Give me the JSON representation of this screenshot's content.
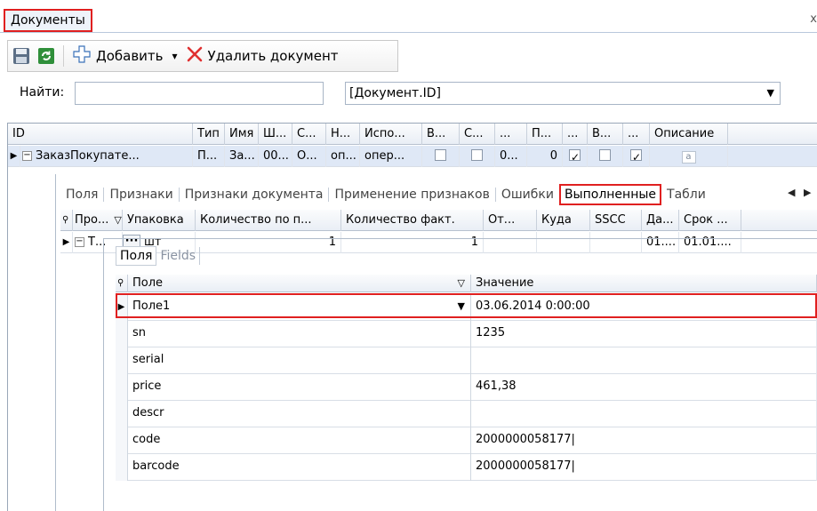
{
  "window": {
    "tab_title": "Документы",
    "close_glyph": "x"
  },
  "toolbar": {
    "save_icon": "save-icon",
    "refresh_icon": "refresh-icon",
    "add_label": "Добавить",
    "add_dropdown_glyph": "▾",
    "delete_label": "Удалить документ"
  },
  "search": {
    "label": "Найти:",
    "value": "",
    "field_value": "[Документ.ID]"
  },
  "grid": {
    "headers": [
      "ID",
      "Тип",
      "Имя",
      "Ш...",
      "С...",
      "Н...",
      "Испо...",
      "В...",
      "С...",
      "...",
      "П...",
      "...",
      "В...",
      "...",
      "Описание"
    ],
    "row": {
      "id": "ЗаказПокупате...",
      "type": "П...",
      "name": "За...",
      "sh": "00...",
      "s": "О...",
      "n": "оп...",
      "ispo": "опер...",
      "b_checked": false,
      "c_checked": false,
      "dots1": "0...",
      "p": "0",
      "dots2_checked": true,
      "v_checked": false,
      "dots3_checked": true,
      "description_icon": "a"
    }
  },
  "detail_tabs": [
    "Поля",
    "Признаки",
    "Признаки документа",
    "Применение признаков",
    "Ошибки",
    "Выполненные",
    "Табли"
  ],
  "detail_tabs_active": "Выполненные",
  "executed": {
    "headers": [
      "Про...",
      "Упаковка",
      "Количество по п...",
      "Количество факт.",
      "От...",
      "Куда",
      "SSCC",
      "Да...",
      "Срок ..."
    ],
    "row": {
      "pro": "Т...",
      "ellipsis_button": "···",
      "pack": "шт",
      "qty_plan": "1",
      "qty_fact": "1",
      "from": "",
      "to": "",
      "sscc": "",
      "date": "01....",
      "term": "01.01...."
    }
  },
  "inner_tabs": [
    "Поля",
    "Fields"
  ],
  "fields": {
    "headers": {
      "field": "Поле",
      "value": "Значение"
    },
    "rows": [
      {
        "field": "Поле1",
        "value": "03.06.2014 0:00:00",
        "has_dropdown": true
      },
      {
        "field": "sn",
        "value": "1235"
      },
      {
        "field": "serial",
        "value": ""
      },
      {
        "field": "price",
        "value": "461,38"
      },
      {
        "field": "descr",
        "value": ""
      },
      {
        "field": "code",
        "value": "2000000058177|"
      },
      {
        "field": "barcode",
        "value": "2000000058177|"
      }
    ]
  },
  "colors": {
    "highlight": "#e02020",
    "header_bg": "#e9eef5",
    "border": "#9aa7b8"
  }
}
